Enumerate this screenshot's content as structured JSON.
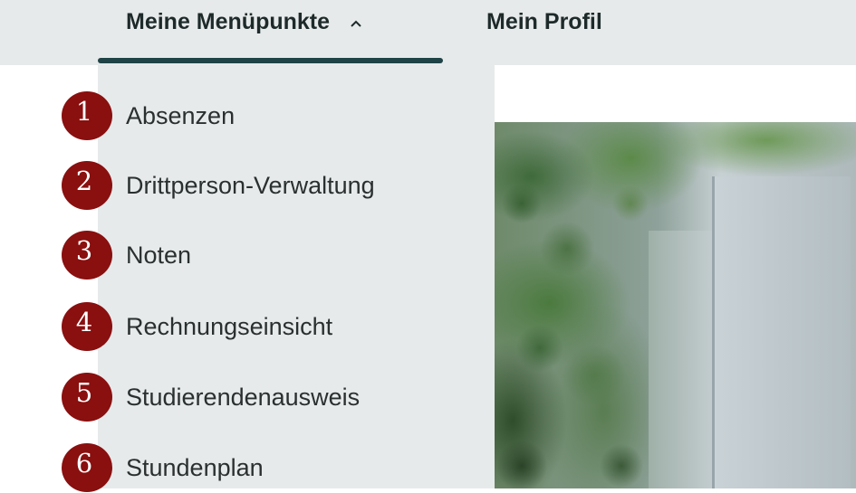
{
  "topnav": {
    "menu_label": "Meine Menüpunkte",
    "profile_label": "Mein Profil"
  },
  "dropdown": {
    "items": [
      {
        "number": "1",
        "label": "Absenzen"
      },
      {
        "number": "2",
        "label": "Drittperson-Verwaltung"
      },
      {
        "number": "3",
        "label": "Noten"
      },
      {
        "number": "4",
        "label": "Rechnungseinsicht"
      },
      {
        "number": "5",
        "label": "Studierendenausweis"
      },
      {
        "number": "6",
        "label": "Stundenplan"
      }
    ]
  },
  "colors": {
    "nav_background": "#e7eaeb",
    "underline": "#1f4346",
    "badge": "#8a0f0f",
    "text": "#1e2a2a"
  },
  "icons": {
    "menu_toggle": "chevron-up-icon"
  }
}
